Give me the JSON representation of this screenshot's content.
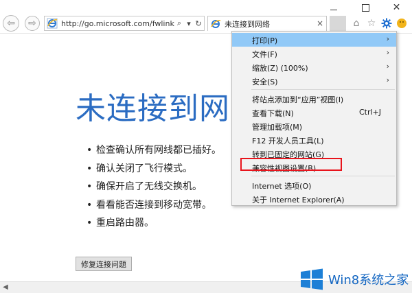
{
  "window": {
    "minimize_icon": "minimize-icon",
    "maximize_icon": "maximize-icon",
    "close_glyph": "✕"
  },
  "toolbar": {
    "back_glyph": "⇦",
    "forward_glyph": "⇨",
    "address_url": "http://go.microsoft.com/fwlink",
    "search_glyph": "⌕",
    "refresh_glyph": "↻",
    "tab_title": "未连接到网络",
    "tab_close": "×",
    "home_glyph": "⌂",
    "star_glyph": "☆"
  },
  "page": {
    "headline": "未连接到网",
    "bullets": [
      "检查确认所有网线都已插好。",
      "确认关闭了飞行模式。",
      "确保开启了无线交换机。",
      "看看能否连接到移动宽带。",
      "重启路由器。"
    ],
    "fix_button": "修复连接问题"
  },
  "menu": {
    "items": [
      {
        "label": "打印(P)",
        "submenu": "›",
        "shortcut": ""
      },
      {
        "label": "文件(F)",
        "submenu": "›",
        "shortcut": ""
      },
      {
        "label": "缩放(Z) (100%)",
        "submenu": "›",
        "shortcut": ""
      },
      {
        "label": "安全(S)",
        "submenu": "›",
        "shortcut": ""
      },
      {
        "label": "将站点添加到“应用”视图(I)",
        "submenu": "",
        "shortcut": ""
      },
      {
        "label": "查看下载(N)",
        "submenu": "",
        "shortcut": "Ctrl+J"
      },
      {
        "label": "管理加载项(M)",
        "submenu": "",
        "shortcut": ""
      },
      {
        "label": "F12 开发人员工具(L)",
        "submenu": "",
        "shortcut": ""
      },
      {
        "label": "转到已固定的网站(G)",
        "submenu": "",
        "shortcut": ""
      },
      {
        "label": "兼容性视图设置(B)",
        "submenu": "",
        "shortcut": ""
      },
      {
        "label": "Internet 选项(O)",
        "submenu": "",
        "shortcut": ""
      },
      {
        "label": "关于 Internet Explorer(A)",
        "submenu": "",
        "shortcut": ""
      }
    ],
    "highlight_color": "#91c9f7",
    "annotation_color": "#e8141c"
  },
  "scrollbar": {
    "left_glyph": "◀"
  },
  "watermark": {
    "text": "Win8系统之家"
  },
  "colors": {
    "headline": "#2b6cc2",
    "gear": "#1f6fd1",
    "watermark": "#1567c2"
  }
}
